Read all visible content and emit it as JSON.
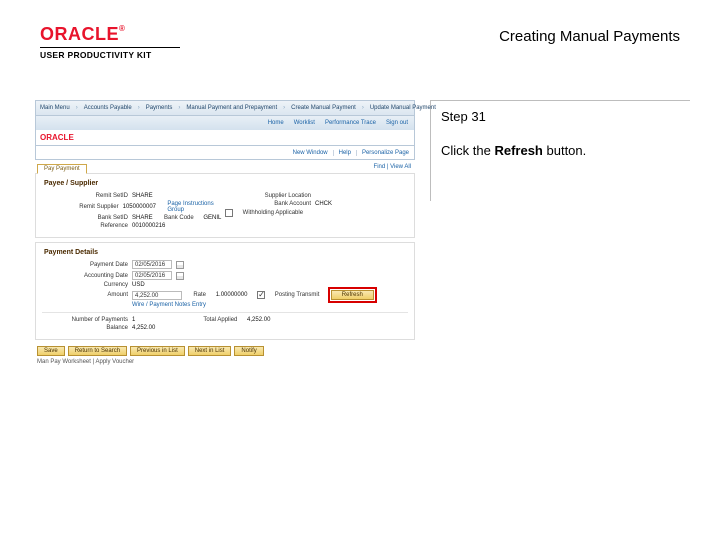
{
  "brand": {
    "logo": "ORACLE",
    "trademark": "®",
    "sub": "USER PRODUCTIVITY KIT"
  },
  "doc": {
    "title": "Creating Manual Payments"
  },
  "instruction": {
    "step_label": "Step 31",
    "line_pre": "Click the ",
    "line_bold": "Refresh",
    "line_post": " button."
  },
  "app": {
    "oracle_logo": "ORACLE",
    "breadcrumbs": [
      "Main Menu",
      "Accounts Payable",
      "Payments",
      "Manual Payment and Prepayment",
      "Create Manual Payment",
      "Update Manual Payment"
    ],
    "subbar": [
      "Home",
      "Worklist",
      "Performance Trace",
      "Sign out"
    ],
    "toolbar_links": [
      "New Window",
      "Help",
      "Personalize Page"
    ],
    "tab_label": "Pay Payment",
    "find_link": "Find | View All",
    "section1_title": "Payee / Supplier",
    "s1": {
      "remit_label": "Remit SetID",
      "remit_value": "SHARE",
      "remit_supplier_label": "Remit Supplier",
      "remit_supplier_value": "1050000007",
      "page_instructions": "Page Instructions Group",
      "supplier_location_label": "Supplier Location",
      "bank_label": "Bank SetID",
      "bank_value": "SHARE",
      "bank_code_label": "Bank Code",
      "bank_code_value": "GENIL",
      "bank_account_label": "Bank Account",
      "bank_account_value": "CHCK",
      "reference_label": "Reference",
      "reference_value": "0010000216",
      "wh_label": "Withholding Applicable"
    },
    "section2_title": "Payment Details",
    "s2": {
      "payment_date_label": "Payment Date",
      "payment_date_value": "02/05/2016",
      "acct_date_label": "Accounting Date",
      "acct_date_value": "02/05/2016",
      "curr_label": "Currency",
      "curr_value": "USD",
      "amount_label": "Amount",
      "amount_value": "4,252.00",
      "rate_label": "Rate",
      "rate_value": "1.00000000",
      "pt_label": "Posting Transmit",
      "refresh": "Refresh",
      "wire_link": "Wire / Payment Notes Entry",
      "num_pay_label": "Number of Payments",
      "num_pay_value": "1",
      "total_applied_label": "Total Applied",
      "total_applied_value": "4,252.00",
      "balance_label": "Balance",
      "balance_value": "4,252.00"
    },
    "actions": {
      "save": "Save",
      "return": "Return to Search",
      "prev": "Previous in List",
      "next": "Next in List",
      "notify": "Notify"
    },
    "related_label": "Man Pay Worksheet | Apply Voucher"
  }
}
